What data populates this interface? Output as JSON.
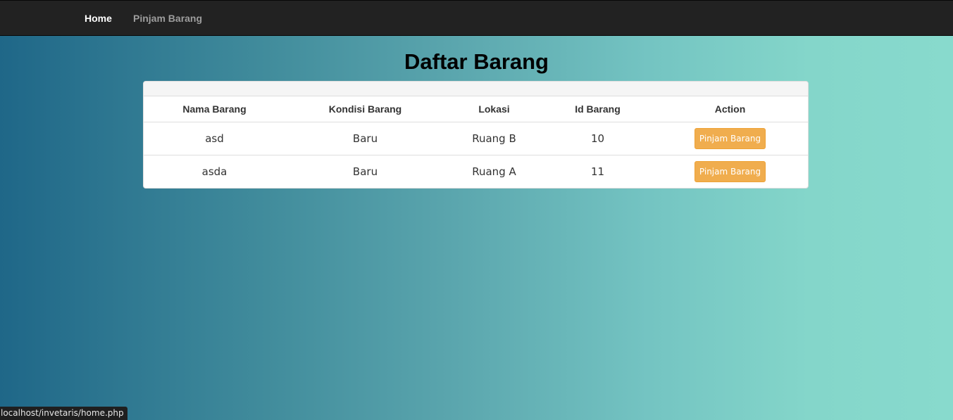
{
  "navbar": {
    "home_label": "Home",
    "pinjam_label": "Pinjam Barang"
  },
  "page": {
    "title": "Daftar Barang"
  },
  "table": {
    "headers": [
      "Nama Barang",
      "Kondisi Barang",
      "Lokasi",
      "Id Barang",
      "Action"
    ],
    "rows": [
      {
        "nama": "asd",
        "kondisi": "Baru",
        "lokasi": "Ruang B",
        "id": "10",
        "action_label": "Pinjam Barang"
      },
      {
        "nama": "asda",
        "kondisi": "Baru",
        "lokasi": "Ruang A",
        "id": "11",
        "action_label": "Pinjam Barang"
      }
    ]
  },
  "status_bar": {
    "url": "localhost/invetaris/home.php"
  },
  "colors": {
    "navbar_bg": "#222222",
    "button_warning": "#f0ad4e",
    "gradient_start": "#1f6788",
    "gradient_end": "#88dacd"
  }
}
